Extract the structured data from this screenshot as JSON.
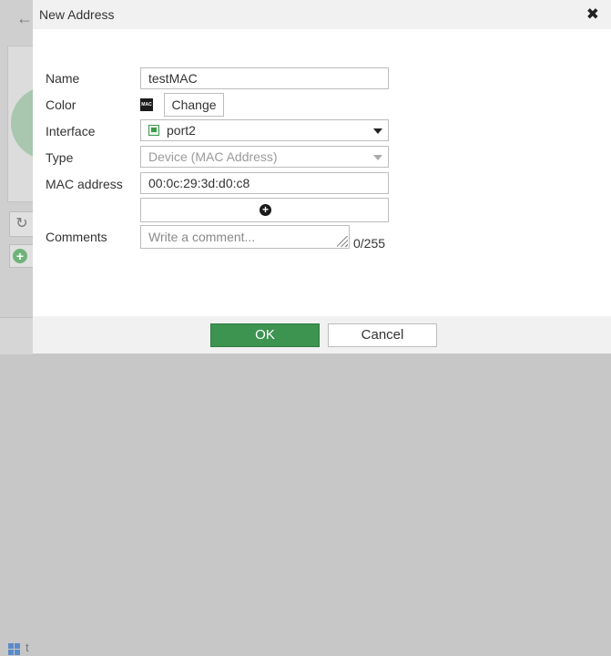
{
  "dialog": {
    "title": "New Address",
    "close_icon": "close-icon"
  },
  "form": {
    "name_label": "Name",
    "name_value": "testMAC",
    "color_label": "Color",
    "color_swatch_text": "MAC",
    "change_label": "Change",
    "interface_label": "Interface",
    "interface_value": "port2",
    "type_label": "Type",
    "type_value": "Device (MAC Address)",
    "mac_label": "MAC address",
    "mac_value": "00:0c:29:3d:d0:c8",
    "comments_label": "Comments",
    "comments_placeholder": "Write a comment...",
    "comments_counter": "0/255"
  },
  "footer": {
    "ok_label": "OK",
    "cancel_label": "Cancel"
  },
  "colors": {
    "ok_green": "#3d9350",
    "header_bg": "#f1f1f1"
  }
}
